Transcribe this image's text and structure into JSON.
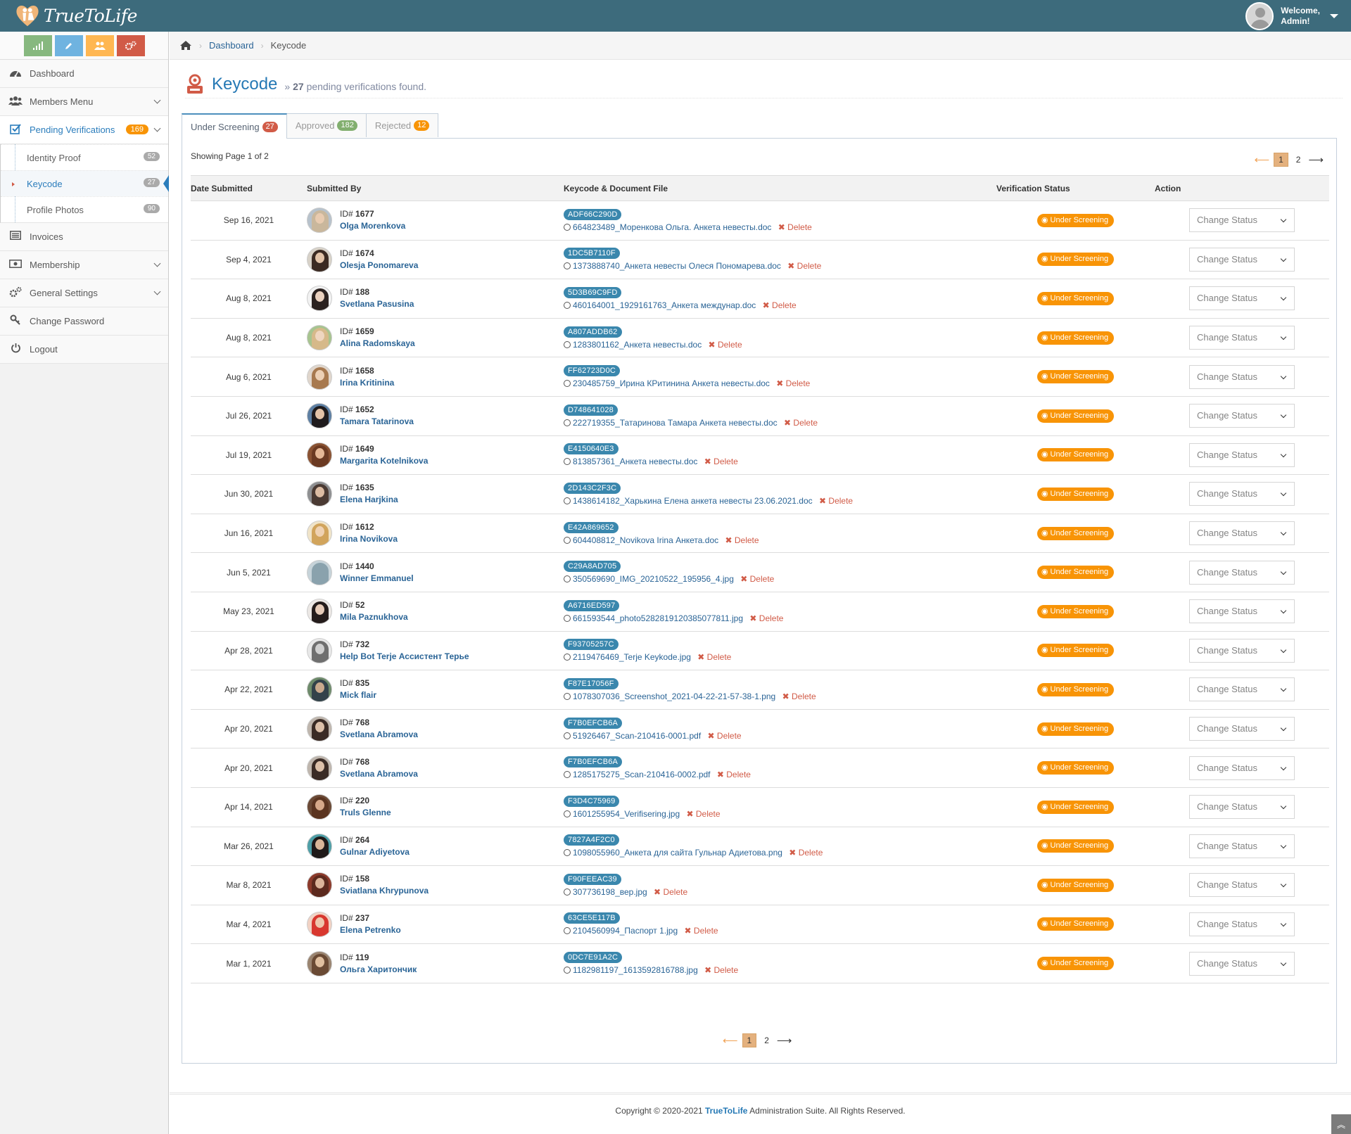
{
  "app": {
    "brand_name": "TrueToLife"
  },
  "user": {
    "welcome": "Welcome,",
    "name": "Admin!"
  },
  "shortcuts": [
    {
      "icon": "signal-icon",
      "color": "#87b87f"
    },
    {
      "icon": "pencil-icon",
      "color": "#6fb3e0"
    },
    {
      "icon": "users-icon",
      "color": "#ffb752"
    },
    {
      "icon": "cogs-icon",
      "color": "#d15b47"
    }
  ],
  "sidebar": {
    "dashboard": "Dashboard",
    "members_menu": "Members Menu",
    "pending_verifications": "Pending Verifications",
    "pending_count": "169",
    "sub": [
      {
        "label": "Identity Proof",
        "count": "52"
      },
      {
        "label": "Keycode",
        "count": "27"
      },
      {
        "label": "Profile Photos",
        "count": "90"
      }
    ],
    "invoices": "Invoices",
    "membership": "Membership",
    "general_settings": "General Settings",
    "change_password": "Change Password",
    "logout": "Logout"
  },
  "breadcrumb": {
    "home": "Dashboard",
    "current": "Keycode"
  },
  "header": {
    "title": "Keycode",
    "prefix": "»",
    "count": "27",
    "suffix": "pending verifications found."
  },
  "tabs": [
    {
      "label": "Under Screening",
      "count": "27",
      "color": "#d15b47"
    },
    {
      "label": "Approved",
      "count": "182",
      "color": "#82af6f"
    },
    {
      "label": "Rejected",
      "count": "12",
      "color": "#f89406"
    }
  ],
  "showing": "Showing Page 1 of 2",
  "pagination": {
    "prev": "⟵",
    "pages": [
      "1",
      "2"
    ],
    "next": "⟶"
  },
  "columns": [
    "Date Submitted",
    "Submitted By",
    "Keycode & Document File",
    "Verification Status",
    "Action"
  ],
  "status_label": "Under Screening",
  "action_label": "Change Status",
  "delete_label": "Delete",
  "id_prefix": "ID#",
  "rows": [
    {
      "date": "Sep 16, 2021",
      "id": "1677",
      "name": "Olga Morenkova",
      "code": "ADF66C290D",
      "file": "664823489_Моренкова Ольга. Анкета невесты.doc",
      "hair": "#c9b79c",
      "skin": "#e8cbb0",
      "bg": "#b7c2cc"
    },
    {
      "date": "Sep 4, 2021",
      "id": "1674",
      "name": "Olesja Ponomareva",
      "code": "1DC5B7110F",
      "file": "1373888740_Анкета невесты Олеся Пономарева.doc",
      "hair": "#3b2a22",
      "skin": "#e2c3a8",
      "bg": "#d8d2c8"
    },
    {
      "date": "Aug 8, 2021",
      "id": "188",
      "name": "Svetlana Pasusina",
      "code": "5D3B69C9FD",
      "file": "460164001_1929161763_Анкета междунар.doc",
      "hair": "#2b2220",
      "skin": "#ead1bf",
      "bg": "#f2f2f2"
    },
    {
      "date": "Aug 8, 2021",
      "id": "1659",
      "name": "Alina Radomskaya",
      "code": "A807ADDB62",
      "file": "1283801162_Анкета невесты.doc",
      "hair": "#d6b98a",
      "skin": "#efd6c0",
      "bg": "#a7c48f"
    },
    {
      "date": "Aug 6, 2021",
      "id": "1658",
      "name": "Irina Kritinina",
      "code": "FF62723D0C",
      "file": "230485759_Ирина КРитинина Анкета невесты.doc",
      "hair": "#a7794f",
      "skin": "#ecd0b5",
      "bg": "#e0d6cc"
    },
    {
      "date": "Jul 26, 2021",
      "id": "1652",
      "name": "Tamara Tatarinova",
      "code": "D748641028",
      "file": "222719355_Татаринова Тамара Анкета невесты.doc",
      "hair": "#1f1b1d",
      "skin": "#e3c2a7",
      "bg": "#5d7fa3"
    },
    {
      "date": "Jul 19, 2021",
      "id": "1649",
      "name": "Margarita Kotelnikova",
      "code": "E4150640E3",
      "file": "813857361_Анкета невесты.doc",
      "hair": "#6b3a22",
      "skin": "#e5b896",
      "bg": "#8a5232"
    },
    {
      "date": "Jun 30, 2021",
      "id": "1635",
      "name": "Elena Harjkina",
      "code": "2D143C2F3C",
      "file": "1438614182_Харькина Елена анкета невесты 23.06.2021.doc",
      "hair": "#4a3a33",
      "skin": "#dcbca3",
      "bg": "#8e8f91"
    },
    {
      "date": "Jun 16, 2021",
      "id": "1612",
      "name": "Irina Novikova",
      "code": "E42A869652",
      "file": "604408812_Novikova Irina Анкета.doc",
      "hair": "#d1a45c",
      "skin": "#efd2b3",
      "bg": "#f0e4c9"
    },
    {
      "date": "Jun 5, 2021",
      "id": "1440",
      "name": "Winner Emmanuel",
      "code": "C29A8AD705",
      "file": "350569690_IMG_20210522_195956_4.jpg",
      "hair": "#8aa2ad",
      "skin": "#8aa2ad",
      "bg": "#c6d3d9"
    },
    {
      "date": "May 23, 2021",
      "id": "52",
      "name": "Mila Paznukhova",
      "code": "A6716ED597",
      "file": "661593544_photo5282819120385077811.jpg",
      "hair": "#241c1b",
      "skin": "#e6cbb8",
      "bg": "#ece8e5"
    },
    {
      "date": "Apr 28, 2021",
      "id": "732",
      "name": "Help Bot Terje Ассистент Терье",
      "code": "F93705257C",
      "file": "2119476469_Terje Keykode.jpg",
      "hair": "#6f6f6f",
      "skin": "#cfcfcf",
      "bg": "#e8e8e8"
    },
    {
      "date": "Apr 22, 2021",
      "id": "835",
      "name": "Mick flair",
      "code": "F87E17056F",
      "file": "1078307036_Screenshot_2021-04-22-21-57-38-1.png",
      "hair": "#33424a",
      "skin": "#c9a98d",
      "bg": "#6d8a6a"
    },
    {
      "date": "Apr 20, 2021",
      "id": "768",
      "name": "Svetlana Abramova",
      "code": "F7B0EFCB6A",
      "file": "51926467_Scan-210416-0001.pdf",
      "hair": "#3a2b25",
      "skin": "#dcc0a9",
      "bg": "#bfb6ad"
    },
    {
      "date": "Apr 20, 2021",
      "id": "768",
      "name": "Svetlana Abramova",
      "code": "F7B0EFCB6A",
      "file": "1285175275_Scan-210416-0002.pdf",
      "hair": "#3a2b25",
      "skin": "#dcc0a9",
      "bg": "#bfb6ad"
    },
    {
      "date": "Apr 14, 2021",
      "id": "220",
      "name": "Truls Glenne",
      "code": "F3D4C75969",
      "file": "1601255954_Verifisering.jpg",
      "hair": "#5a3420",
      "skin": "#d6a98a",
      "bg": "#6b4a36"
    },
    {
      "date": "Mar 26, 2021",
      "id": "264",
      "name": "Gulnar Adiyetova",
      "code": "7827A4F2C0",
      "file": "1098055960_Анкета для сайта Гульнар Адиетова.png",
      "hair": "#1f1a19",
      "skin": "#d9b698",
      "bg": "#4e9fa7"
    },
    {
      "date": "Mar 8, 2021",
      "id": "158",
      "name": "Sviatlana Khrypunova",
      "code": "F90FEEAC39",
      "file": "307736198_вер.jpg",
      "hair": "#5c2a1e",
      "skin": "#dcb49a",
      "bg": "#8c3a2b"
    },
    {
      "date": "Mar 4, 2021",
      "id": "237",
      "name": "Elena Petrenko",
      "code": "63CE5E117B",
      "file": "2104560994_Паспорт 1.jpg",
      "hair": "#d8382f",
      "skin": "#eec7ad",
      "bg": "#f1d2c4"
    },
    {
      "date": "Mar 1, 2021",
      "id": "119",
      "name": "Ольга Харитончик",
      "code": "0DC7E91A2C",
      "file": "1182981197_1613592816788.jpg",
      "hair": "#6a4a34",
      "skin": "#e0bf9f",
      "bg": "#9a8470"
    }
  ],
  "footer": {
    "prefix": "Copyright © 2020-2021",
    "brand": "TrueToLife",
    "suffix": "Administration Suite. All Rights Reserved."
  }
}
